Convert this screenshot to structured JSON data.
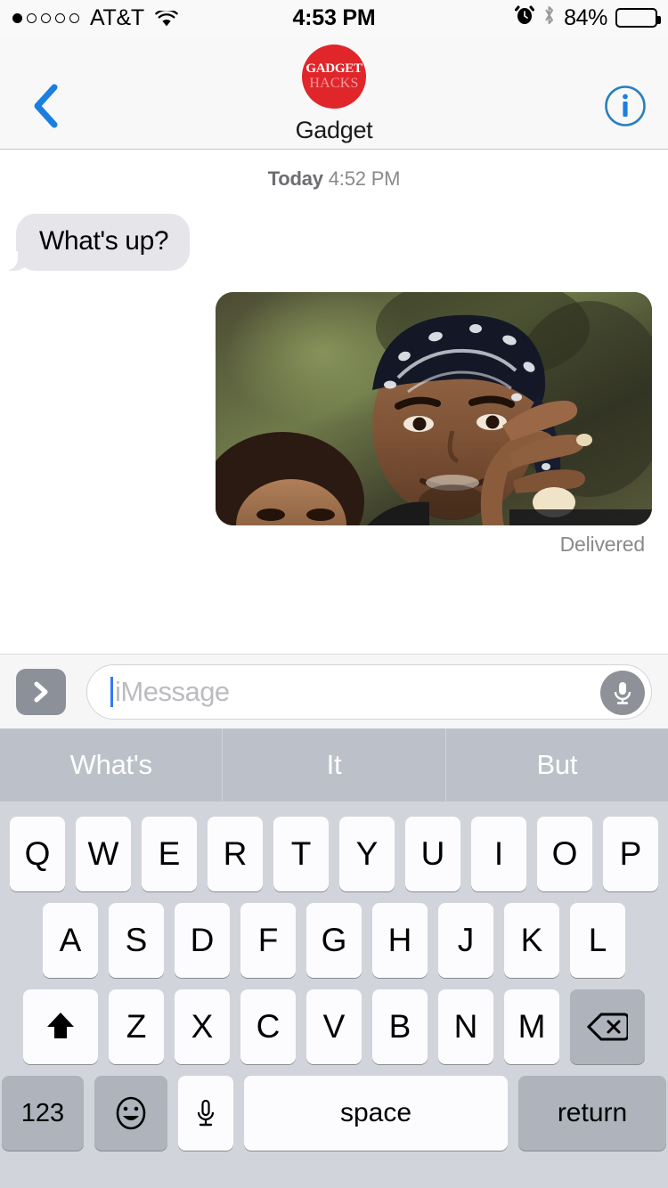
{
  "status_bar": {
    "signal_dots_total": 5,
    "signal_dots_filled": 1,
    "carrier": "AT&T",
    "wifi_icon": "wifi-icon",
    "time": "4:53 PM",
    "alarm_icon": "alarm-clock-icon",
    "bluetooth_icon": "bluetooth-icon",
    "battery_percent": "84%",
    "battery_level": 84
  },
  "nav": {
    "back_icon": "chevron-left-icon",
    "info_icon": "info-circle-icon",
    "avatar": {
      "line1": "GADGET",
      "line2": "HACKS",
      "color": "#E0262B"
    },
    "contact_name": "Gadget"
  },
  "conversation": {
    "timestamp_day": "Today",
    "timestamp_time": "4:52 PM",
    "messages": [
      {
        "type": "text",
        "direction": "incoming",
        "text": "What's up?"
      },
      {
        "type": "image",
        "direction": "outgoing",
        "alt": "2pac-gif",
        "status": "Delivered"
      }
    ]
  },
  "input_bar": {
    "expand_icon": "chevron-right-icon",
    "placeholder": "iMessage",
    "value": "",
    "mic_icon": "microphone-icon",
    "caret_color": "#3478F6"
  },
  "keyboard": {
    "predictions": [
      "What's",
      "It",
      "But"
    ],
    "row1": [
      "Q",
      "W",
      "E",
      "R",
      "T",
      "Y",
      "U",
      "I",
      "O",
      "P"
    ],
    "row2": [
      "A",
      "S",
      "D",
      "F",
      "G",
      "H",
      "J",
      "K",
      "L"
    ],
    "row3": [
      "Z",
      "X",
      "C",
      "V",
      "B",
      "N",
      "M"
    ],
    "shift_icon": "shift-arrow-up-icon",
    "backspace_icon": "backspace-delete-icon",
    "numbers_key": "123",
    "emoji_icon": "smiley-face-icon",
    "dictation_icon": "microphone-icon",
    "space_key": "space",
    "return_key": "return"
  }
}
